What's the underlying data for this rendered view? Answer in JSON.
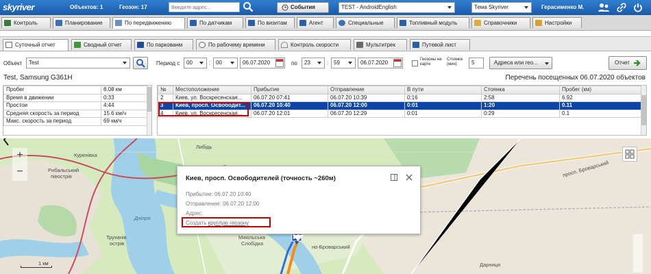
{
  "topbar": {
    "logo": "skyriver",
    "objects_label": "Объектов: 1",
    "geozones_label": "Геозон: 17",
    "address_placeholder": "Введите адрес...",
    "events_button": "События",
    "object_select": "TEST - AndroidEnglish",
    "theme_select": "Тема Skyriver",
    "user_name": "Герасименко М."
  },
  "main_tabs": [
    {
      "label": "Контроль"
    },
    {
      "label": "Планирование"
    },
    {
      "label": "По передвижению"
    },
    {
      "label": "По датчикам"
    },
    {
      "label": "По визитам"
    },
    {
      "label": "Агент"
    },
    {
      "label": "Специальные"
    },
    {
      "label": "Топливный модуль"
    },
    {
      "label": "Справочники"
    },
    {
      "label": "Настройки"
    }
  ],
  "sub_tabs": [
    {
      "label": "Суточный отчет"
    },
    {
      "label": "Сводный отчет"
    },
    {
      "label": "По паркованм"
    },
    {
      "label": "По рабочему времени"
    },
    {
      "label": "Контроль скорости"
    },
    {
      "label": "Мультитрек"
    },
    {
      "label": "Путевой лист"
    }
  ],
  "filters": {
    "object_label": "Объект",
    "object_value": "Test",
    "period_label": "Период с",
    "from_hour": "00",
    "from_min": "00",
    "from_date": "06.07.2020",
    "to_label": "по",
    "to_hour": "23",
    "to_min": "59",
    "to_date": "06.07.2020",
    "geozones_label": "Геозоны на карте",
    "parking_label": "Стоянка (мин)",
    "parking_value": "5",
    "address_mode": "Адреса или гео...",
    "report_button": "Отчет"
  },
  "device_title": "Test, Samsung G361H",
  "list_title": "Перечень посещенных 06.07.2020 объектов",
  "summary": [
    {
      "label": "Пробег",
      "value": "8.08 км"
    },
    {
      "label": "Время в движении",
      "value": "0:33"
    },
    {
      "label": "Простои",
      "value": "4:44"
    },
    {
      "label": "Средняя скорость за период",
      "value": "15.6 км/ч"
    },
    {
      "label": "Макс. скорость за период",
      "value": "69 км/ч"
    }
  ],
  "visits": {
    "headers": [
      "№",
      "Местоположение",
      "Прибытие",
      "Отправление",
      "В пути",
      "Стоянка",
      "Пробег (км)"
    ],
    "rows": [
      [
        "2",
        "Киев, ул. Воскресенская...",
        "06.07.20 07:41",
        "06.07.20 10:39",
        "0:16",
        "2:58",
        "6.92"
      ],
      [
        "3",
        "Киев, просп. Освободит...",
        "06.07.20 10:40",
        "06.07.20 12:00",
        "0:01",
        "1:20",
        "0.11"
      ],
      [
        "4",
        "Киев, ул. Воскресенская...",
        "06.07.20 12:01",
        "06.07.20 12:29",
        "0:01",
        "0:29",
        "0.1"
      ]
    ],
    "selected_index": 1
  },
  "popup": {
    "title": "Киев, просп. Освободителей (точность ~260м)",
    "arrival": "Прибытие: 06.07.20 10:40",
    "departure": "Отправление: 06.07.20 12:00",
    "address": "Адрес:",
    "create_prefix": "Создать ",
    "create_link": "круглую геозону"
  },
  "map": {
    "zoom_in": "+",
    "zoom_out": "−",
    "scale": "1 км",
    "labels": {
      "lybid": "Либідь",
      "rybalsky": "Рибальський",
      "pivostriv": "півострів",
      "trukhaniv": "Труханів",
      "ostriv": "острів",
      "mykilska": "Микільська",
      "slobidka": "Слобідка",
      "brovarsky": "просп. Броварський",
      "darnytsia": "Дарниця",
      "kurenivka": "Куренівка",
      "dnipro": "Дніпро",
      "brovarsky2": "но-Броварський"
    }
  },
  "colors": {
    "topbar": "#1a5aa8",
    "selected_row": "#0b45a8",
    "highlight": "#c00000",
    "map_land": "#cfe4b5",
    "map_water": "#9fd0e8"
  }
}
